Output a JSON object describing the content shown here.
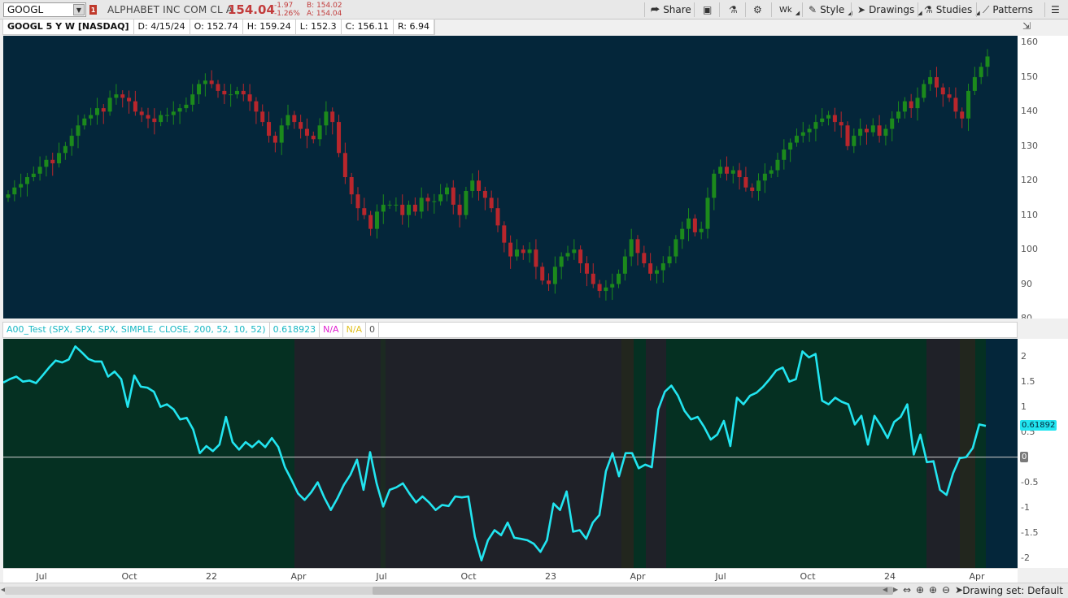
{
  "toolbar": {
    "symbol": "GOOGL",
    "alert_count": "1",
    "company": "ALPHABET INC COM CL A",
    "last": "154.04",
    "change": "-1.97",
    "change_pct": "-1.26%",
    "bid": "B: 154.02",
    "ask": "A: 154.04",
    "share_label": "Share",
    "agg_label": "Wk",
    "style_label": "Style",
    "drawings_label": "Drawings",
    "studies_label": "Studies",
    "patterns_label": "Patterns"
  },
  "price_header": {
    "title": "GOOGL 5 Y W [NASDAQ]",
    "date": "D: 4/15/24",
    "open": "O: 152.74",
    "high": "H: 159.24",
    "low": "L: 152.3",
    "close": "C: 156.11",
    "range": "R: 6.94"
  },
  "study_header": {
    "name": "A00_Test (SPX, SPX, SPX, SIMPLE, CLOSE, 200, 52, 10, 52)",
    "value": "0.618923",
    "na1": "N/A",
    "na2": "N/A",
    "zero": "0"
  },
  "price_axis_labels": [
    "160",
    "150",
    "140",
    "130",
    "120",
    "110",
    "100",
    "90",
    "80"
  ],
  "study_axis_labels": [
    "2",
    "1.5",
    "1",
    "0.5",
    "0",
    "-0.5",
    "-1",
    "-1.5",
    "-2"
  ],
  "study_badges": {
    "current": "0.61892",
    "zero": "0"
  },
  "time_labels": [
    "Jul",
    "Oct",
    "22",
    "Apr",
    "Jul",
    "Oct",
    "23",
    "Apr",
    "Jul",
    "Oct",
    "24",
    "Apr"
  ],
  "status": {
    "drawing_set": "Drawing set: Default"
  },
  "colors": {
    "bg": "#04263a",
    "up": "#1c8a1c",
    "down": "#b8262c",
    "osc": "#22e5f0",
    "zone_green": "#053022",
    "zone_dark": "#1f2128"
  },
  "chart_data": [
    {
      "type": "candlestick",
      "title": "GOOGL 5 Y W [NASDAQ]",
      "ylim": [
        80,
        162
      ],
      "closes": [
        116,
        118,
        119,
        121,
        122,
        124,
        126,
        125,
        128,
        130,
        133,
        136,
        138,
        139,
        141,
        140,
        144,
        145,
        144,
        143,
        140,
        139,
        138,
        137,
        139,
        139,
        140,
        141,
        142,
        145,
        148,
        149,
        148,
        146,
        145,
        145,
        146,
        145,
        143,
        140,
        137,
        133,
        131,
        136,
        139,
        137,
        135,
        133,
        132,
        136,
        140,
        137,
        128,
        121,
        116,
        112,
        110,
        106,
        111,
        113,
        113,
        113,
        110,
        113,
        111,
        115,
        114,
        114,
        116,
        118,
        113,
        110,
        117,
        120,
        117,
        115,
        112,
        107,
        102,
        98,
        100,
        99,
        100,
        95,
        91,
        90,
        95,
        98,
        99,
        100,
        96,
        93,
        90,
        88,
        89,
        90,
        93,
        98,
        103,
        99,
        96,
        93,
        94,
        96,
        98,
        103,
        106,
        109,
        105,
        106,
        115,
        122,
        124,
        122,
        123,
        121,
        118,
        117,
        120,
        122,
        123,
        126,
        129,
        131,
        133,
        134,
        135,
        137,
        138,
        139,
        137,
        136,
        130,
        133,
        135,
        134,
        136,
        133,
        135,
        138,
        140,
        143,
        141,
        144,
        148,
        150,
        147,
        145,
        144,
        140,
        138,
        146,
        150,
        153,
        156
      ],
      "series_note": "weekly OHLC bars"
    },
    {
      "type": "line",
      "title": "A00_Test (SPX, SPX, SPX, SIMPLE, CLOSE, 200, 52, 10, 52)",
      "ylim": [
        -2.2,
        2.35
      ],
      "values": [
        1.48,
        1.55,
        1.6,
        1.5,
        1.52,
        1.47,
        1.62,
        1.78,
        1.92,
        1.88,
        1.94,
        2.2,
        2.08,
        1.95,
        1.9,
        1.9,
        1.6,
        1.7,
        1.55,
        1.0,
        1.62,
        1.4,
        1.38,
        1.3,
        1.0,
        1.05,
        0.95,
        0.75,
        0.78,
        0.55,
        0.08,
        0.22,
        0.12,
        0.25,
        0.8,
        0.3,
        0.15,
        0.3,
        0.2,
        0.32,
        0.2,
        0.38,
        0.2,
        -0.2,
        -0.45,
        -0.72,
        -0.85,
        -0.7,
        -0.5,
        -0.8,
        -1.05,
        -0.82,
        -0.55,
        -0.35,
        -0.05,
        -0.65,
        0.1,
        -0.52,
        -0.98,
        -0.65,
        -0.6,
        -0.52,
        -0.72,
        -0.9,
        -0.78,
        -0.9,
        -1.05,
        -0.95,
        -0.97,
        -0.78,
        -0.8,
        -0.78,
        -1.58,
        -2.05,
        -1.65,
        -1.45,
        -1.55,
        -1.3,
        -1.6,
        -1.62,
        -1.65,
        -1.72,
        -1.88,
        -1.65,
        -0.92,
        -1.05,
        -0.68,
        -1.48,
        -1.45,
        -1.62,
        -1.3,
        -1.15,
        -0.28,
        0.08,
        -0.38,
        0.08,
        0.08,
        -0.22,
        -0.15,
        -0.2,
        0.95,
        1.3,
        1.42,
        1.22,
        0.92,
        0.75,
        0.8,
        0.6,
        0.35,
        0.45,
        0.72,
        0.22,
        1.18,
        1.05,
        1.22,
        1.28,
        1.4,
        1.55,
        1.72,
        1.78,
        1.5,
        1.55,
        2.1,
        1.98,
        2.05,
        1.12,
        1.05,
        1.18,
        1.1,
        1.05,
        0.65,
        0.82,
        0.25,
        0.82,
        0.62,
        0.38,
        0.7,
        0.8,
        1.05,
        0.05,
        0.45,
        -0.1,
        -0.08,
        -0.65,
        -0.75,
        -0.32,
        -0.02,
        0.0,
        0.18,
        0.65,
        0.62
      ],
      "current": 0.618923
    }
  ]
}
